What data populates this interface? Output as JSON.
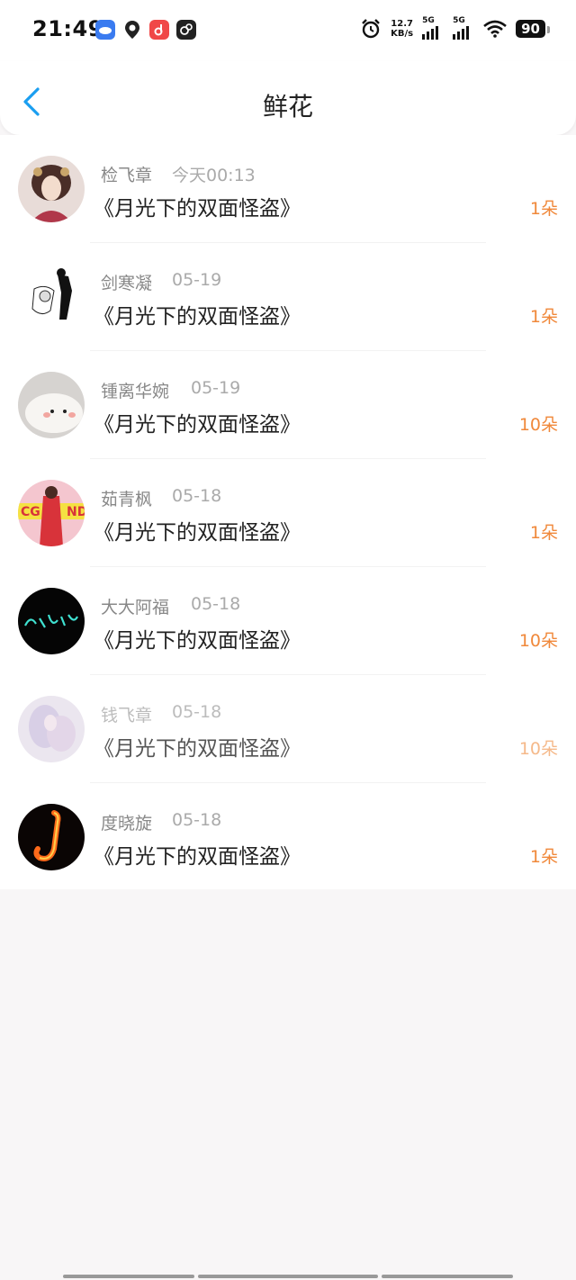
{
  "status_bar": {
    "time": "21:49",
    "app_icons": [
      "cloud-icon",
      "du-map-icon",
      "music-icon",
      "uc-icon"
    ],
    "speed_value": "12.7",
    "speed_unit": "KB/s",
    "signal_1_label": "5G",
    "signal_2_label": "5G",
    "battery": "90"
  },
  "header": {
    "back_icon": "chevron-left-icon",
    "title": "鲜花"
  },
  "colors": {
    "accent": "#1a9ef0",
    "count": "#f0883a"
  },
  "list": [
    {
      "name": "检飞章",
      "date": "今天00:13",
      "book": "《月光下的双面怪盗》",
      "count": "1朵"
    },
    {
      "name": "剑寒凝",
      "date": "05-19",
      "book": "《月光下的双面怪盗》",
      "count": "1朵"
    },
    {
      "name": "锺离华婉",
      "date": "05-19",
      "book": "《月光下的双面怪盗》",
      "count": "10朵"
    },
    {
      "name": "茹青枫",
      "date": "05-18",
      "book": "《月光下的双面怪盗》",
      "count": "1朵"
    },
    {
      "name": "大大阿福",
      "date": "05-18",
      "book": "《月光下的双面怪盗》",
      "count": "10朵"
    },
    {
      "name": "钱飞章",
      "date": "05-18",
      "book": "《月光下的双面怪盗》",
      "count": "10朵"
    },
    {
      "name": "度晓旋",
      "date": "05-18",
      "book": "《月光下的双面怪盗》",
      "count": "1朵"
    }
  ]
}
